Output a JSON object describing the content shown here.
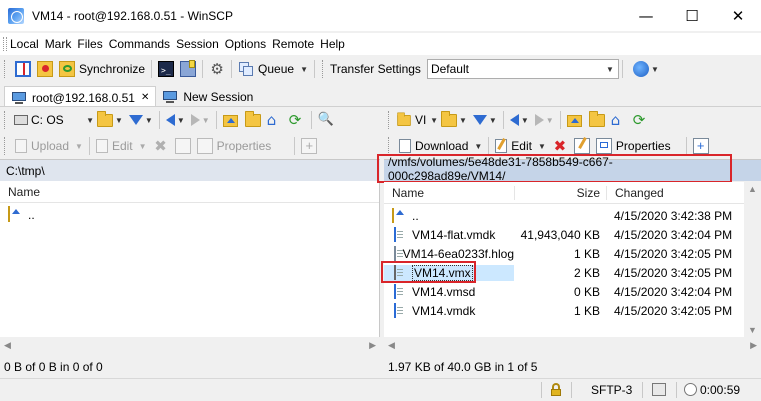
{
  "window": {
    "title": "VM14 - root@192.168.0.51 - WinSCP",
    "min_glyph": "—",
    "max_glyph": "☐",
    "close_glyph": "✕"
  },
  "menu": [
    {
      "label": "Local",
      "name": "menu-local"
    },
    {
      "label": "Mark",
      "name": "menu-mark"
    },
    {
      "label": "Files",
      "name": "menu-files"
    },
    {
      "label": "Commands",
      "name": "menu-commands"
    },
    {
      "label": "Session",
      "name": "menu-session"
    },
    {
      "label": "Options",
      "name": "menu-options"
    },
    {
      "label": "Remote",
      "name": "menu-remote"
    },
    {
      "label": "Help",
      "name": "menu-help"
    }
  ],
  "toolbar": {
    "synchronize": "Synchronize",
    "queue": "Queue",
    "transfer_settings_label": "Transfer Settings",
    "transfer_settings_value": "Default"
  },
  "tabs": {
    "session": "root@192.168.0.51",
    "new_session": "New Session",
    "close_glyph": "✕"
  },
  "local": {
    "drive": "C: OS",
    "upload": "Upload",
    "edit": "Edit",
    "properties": "Properties",
    "path": "C:\\tmp\\",
    "col_name": "Name",
    "files": [
      {
        "name": ".."
      }
    ],
    "status": "0 B of 0 B in 0 of 0"
  },
  "remote": {
    "drive": "VI",
    "download": "Download",
    "edit": "Edit",
    "properties": "Properties",
    "path": "/vmfs/volumes/5e48de31-7858b549-c667-000c298ad89e/VM14/",
    "col_name": "Name",
    "col_size": "Size",
    "col_changed": "Changed",
    "files": [
      {
        "name": "..",
        "size": "",
        "changed": "4/15/2020 3:42:38 PM",
        "icon": "parent-folder"
      },
      {
        "name": "VM14-flat.vmdk",
        "size": "41,943,040 KB",
        "changed": "4/15/2020 3:42:04 PM",
        "icon": "vmdk"
      },
      {
        "name": "VM14-6ea0233f.hlog",
        "size": "1 KB",
        "changed": "4/15/2020 3:42:05 PM",
        "icon": "document"
      },
      {
        "name": "VM14.vmx",
        "size": "2 KB",
        "changed": "4/15/2020 3:42:05 PM",
        "icon": "vmx"
      },
      {
        "name": "VM14.vmsd",
        "size": "0 KB",
        "changed": "4/15/2020 3:42:04 PM",
        "icon": "vmdk"
      },
      {
        "name": "VM14.vmdk",
        "size": "1 KB",
        "changed": "4/15/2020 3:42:05 PM",
        "icon": "vmdk"
      }
    ],
    "status": "1.97 KB of 40.0 GB in 1 of 5"
  },
  "bottom": {
    "protocol": "SFTP-3",
    "time": "0:00:59"
  },
  "colors": {
    "path_bar_bg": "#c5d4e8",
    "highlight_red": "#d9252a",
    "selected_row": "#cce8ff"
  }
}
